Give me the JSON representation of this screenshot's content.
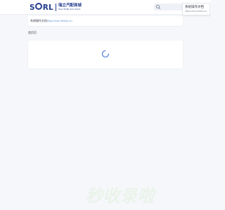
{
  "header": {
    "logo": {
      "mark": "SORL",
      "cn_name": "瑞立汽配商城",
      "en_name": "New SORL Auto Parts"
    },
    "search": {
      "placeholder": "",
      "icon": "search-icon"
    }
  },
  "doc_link": {
    "title": "系统操作文档",
    "url": "https://sorl.feishu.cn"
  },
  "breadcrumb": {
    "label": "首页页"
  },
  "content": {
    "loading_icon": "loading-spinner-icon"
  },
  "popup": {
    "title": "系统操作文档",
    "url": "https://sorl.feishu.cn"
  },
  "watermark": {
    "text": "秒收录啦"
  },
  "colors": {
    "brand": "#243c8e",
    "link": "#5c8fd6",
    "spinner": "#3d6fd6",
    "background": "#f6f7fa",
    "watermark": "#eaf3ea"
  }
}
